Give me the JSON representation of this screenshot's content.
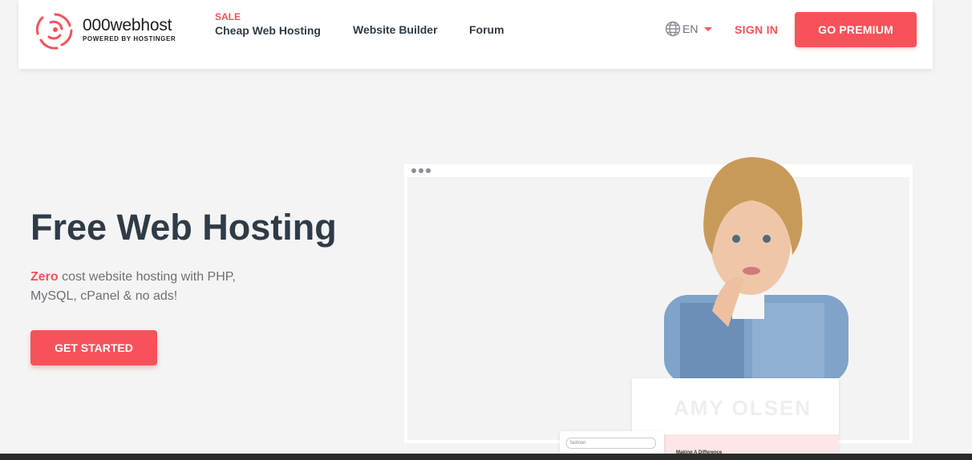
{
  "brand": {
    "name": "000webhost",
    "sub": "POWERED BY HOSTINGER"
  },
  "nav": {
    "sale_badge": "SALE",
    "links": [
      "Cheap Web Hosting",
      "Website Builder",
      "Forum"
    ],
    "lang": "EN",
    "signin": "SIGN IN",
    "premium": "GO PREMIUM"
  },
  "hero": {
    "title": "Free Web Hosting",
    "sub_highlight": "Zero",
    "sub_rest": "cost website hosting with PHP, MySQL, cPanel & no ads!",
    "cta": "GET STARTED"
  },
  "preview": {
    "mini_heading": "AMY OLSEN",
    "mini_tagline": "Making A Difference",
    "search_placeholder": "fashion"
  },
  "colors": {
    "accent": "#f7525a",
    "text_dark": "#2f3b46",
    "text_muted": "#6c7177"
  }
}
